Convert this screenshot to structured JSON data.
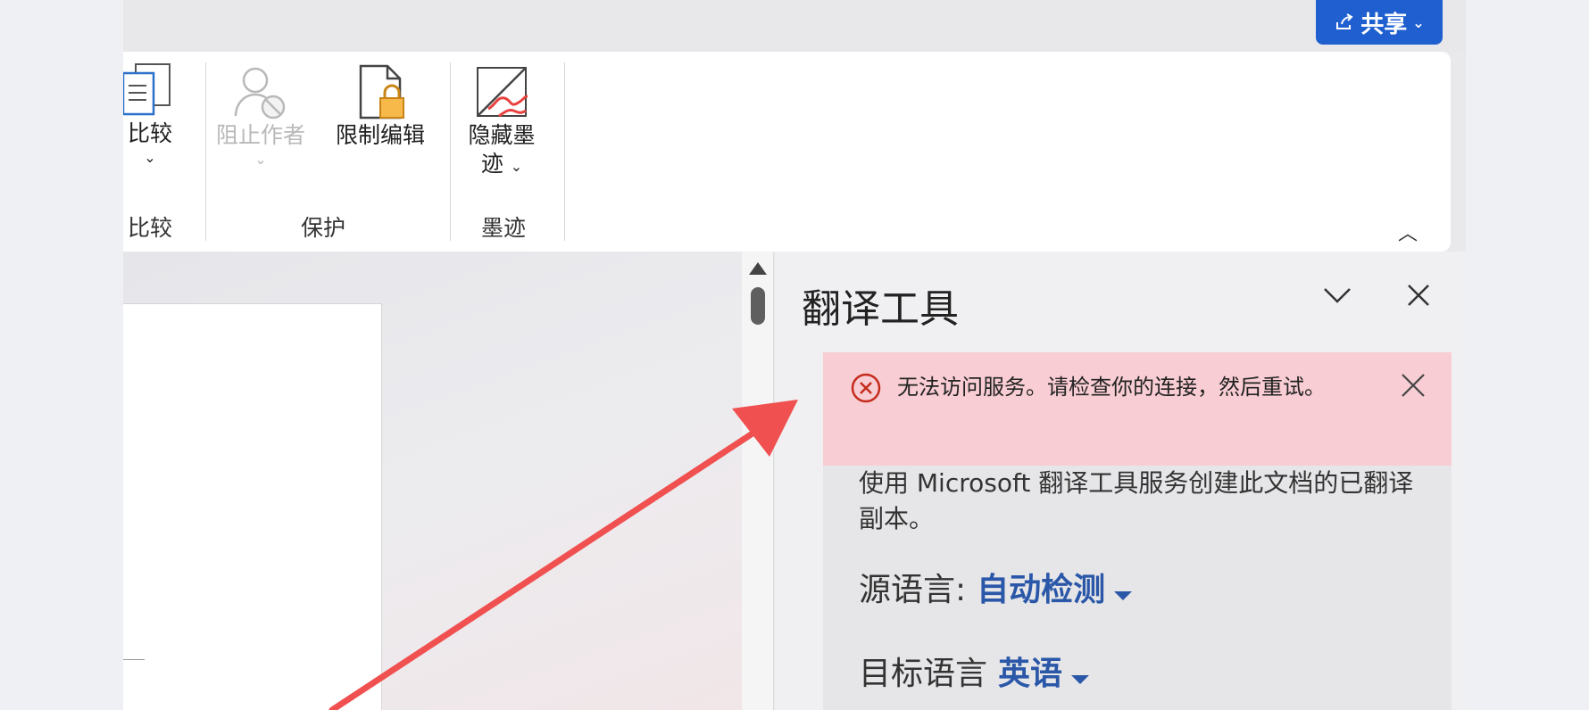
{
  "titlebar": {
    "share_label": "共享"
  },
  "ribbon": {
    "groups": [
      {
        "label": "比较",
        "buttons": [
          {
            "label": "比较"
          }
        ]
      },
      {
        "label": "保护",
        "buttons": [
          {
            "label": "阻止作者",
            "disabled": true
          },
          {
            "label": "限制编辑"
          }
        ]
      },
      {
        "label": "墨迹",
        "buttons": [
          {
            "label_line1": "隐藏墨",
            "label_line2": "迹"
          }
        ]
      }
    ]
  },
  "pane": {
    "title": "翻译工具",
    "error": {
      "message": "无法访问服务。请检查你的连接，然后重试。"
    },
    "description": "使用 Microsoft 翻译工具服务创建此文档的已翻译副本。",
    "source_language": {
      "label": "源语言:",
      "value": "自动检测"
    },
    "target_language": {
      "label": "目标语言",
      "value": "英语"
    }
  },
  "colors": {
    "accent": "#1f5fd0",
    "error_bg": "#f8cdd3",
    "link_blue": "#2a57a8",
    "arrow": "#f05050"
  }
}
